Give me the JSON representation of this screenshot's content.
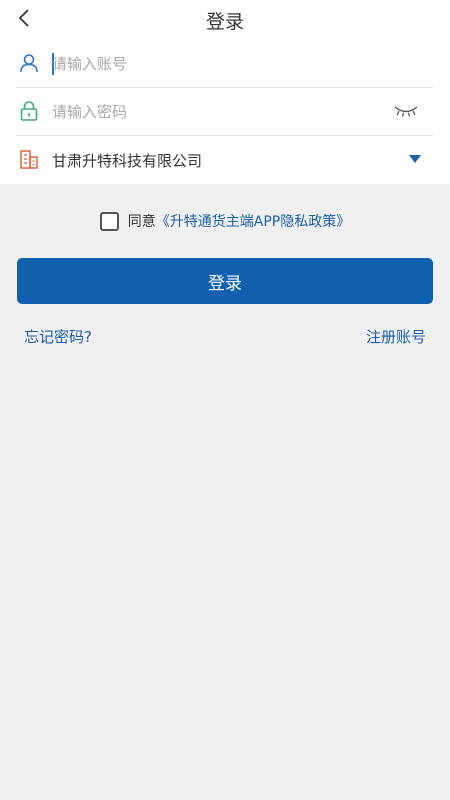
{
  "header": {
    "title": "登录"
  },
  "form": {
    "account": {
      "placeholder": "请输入账号",
      "value": ""
    },
    "password": {
      "placeholder": "请输入密码",
      "value": ""
    },
    "company": {
      "selected": "甘肃升特科技有限公司"
    }
  },
  "agreement": {
    "prefix": "同意",
    "link": "《升特通货主端APP隐私政策》",
    "checked": false
  },
  "actions": {
    "login_label": "登录",
    "forgot_label": "忘记密码?",
    "register_label": "注册账号"
  },
  "colors": {
    "primary": "#1160b0",
    "link": "#1a5fa8",
    "background": "#f0f0f0",
    "user_icon": "#2a74d0",
    "lock_icon": "#3aae7c",
    "company_icon": "#e2673a"
  }
}
